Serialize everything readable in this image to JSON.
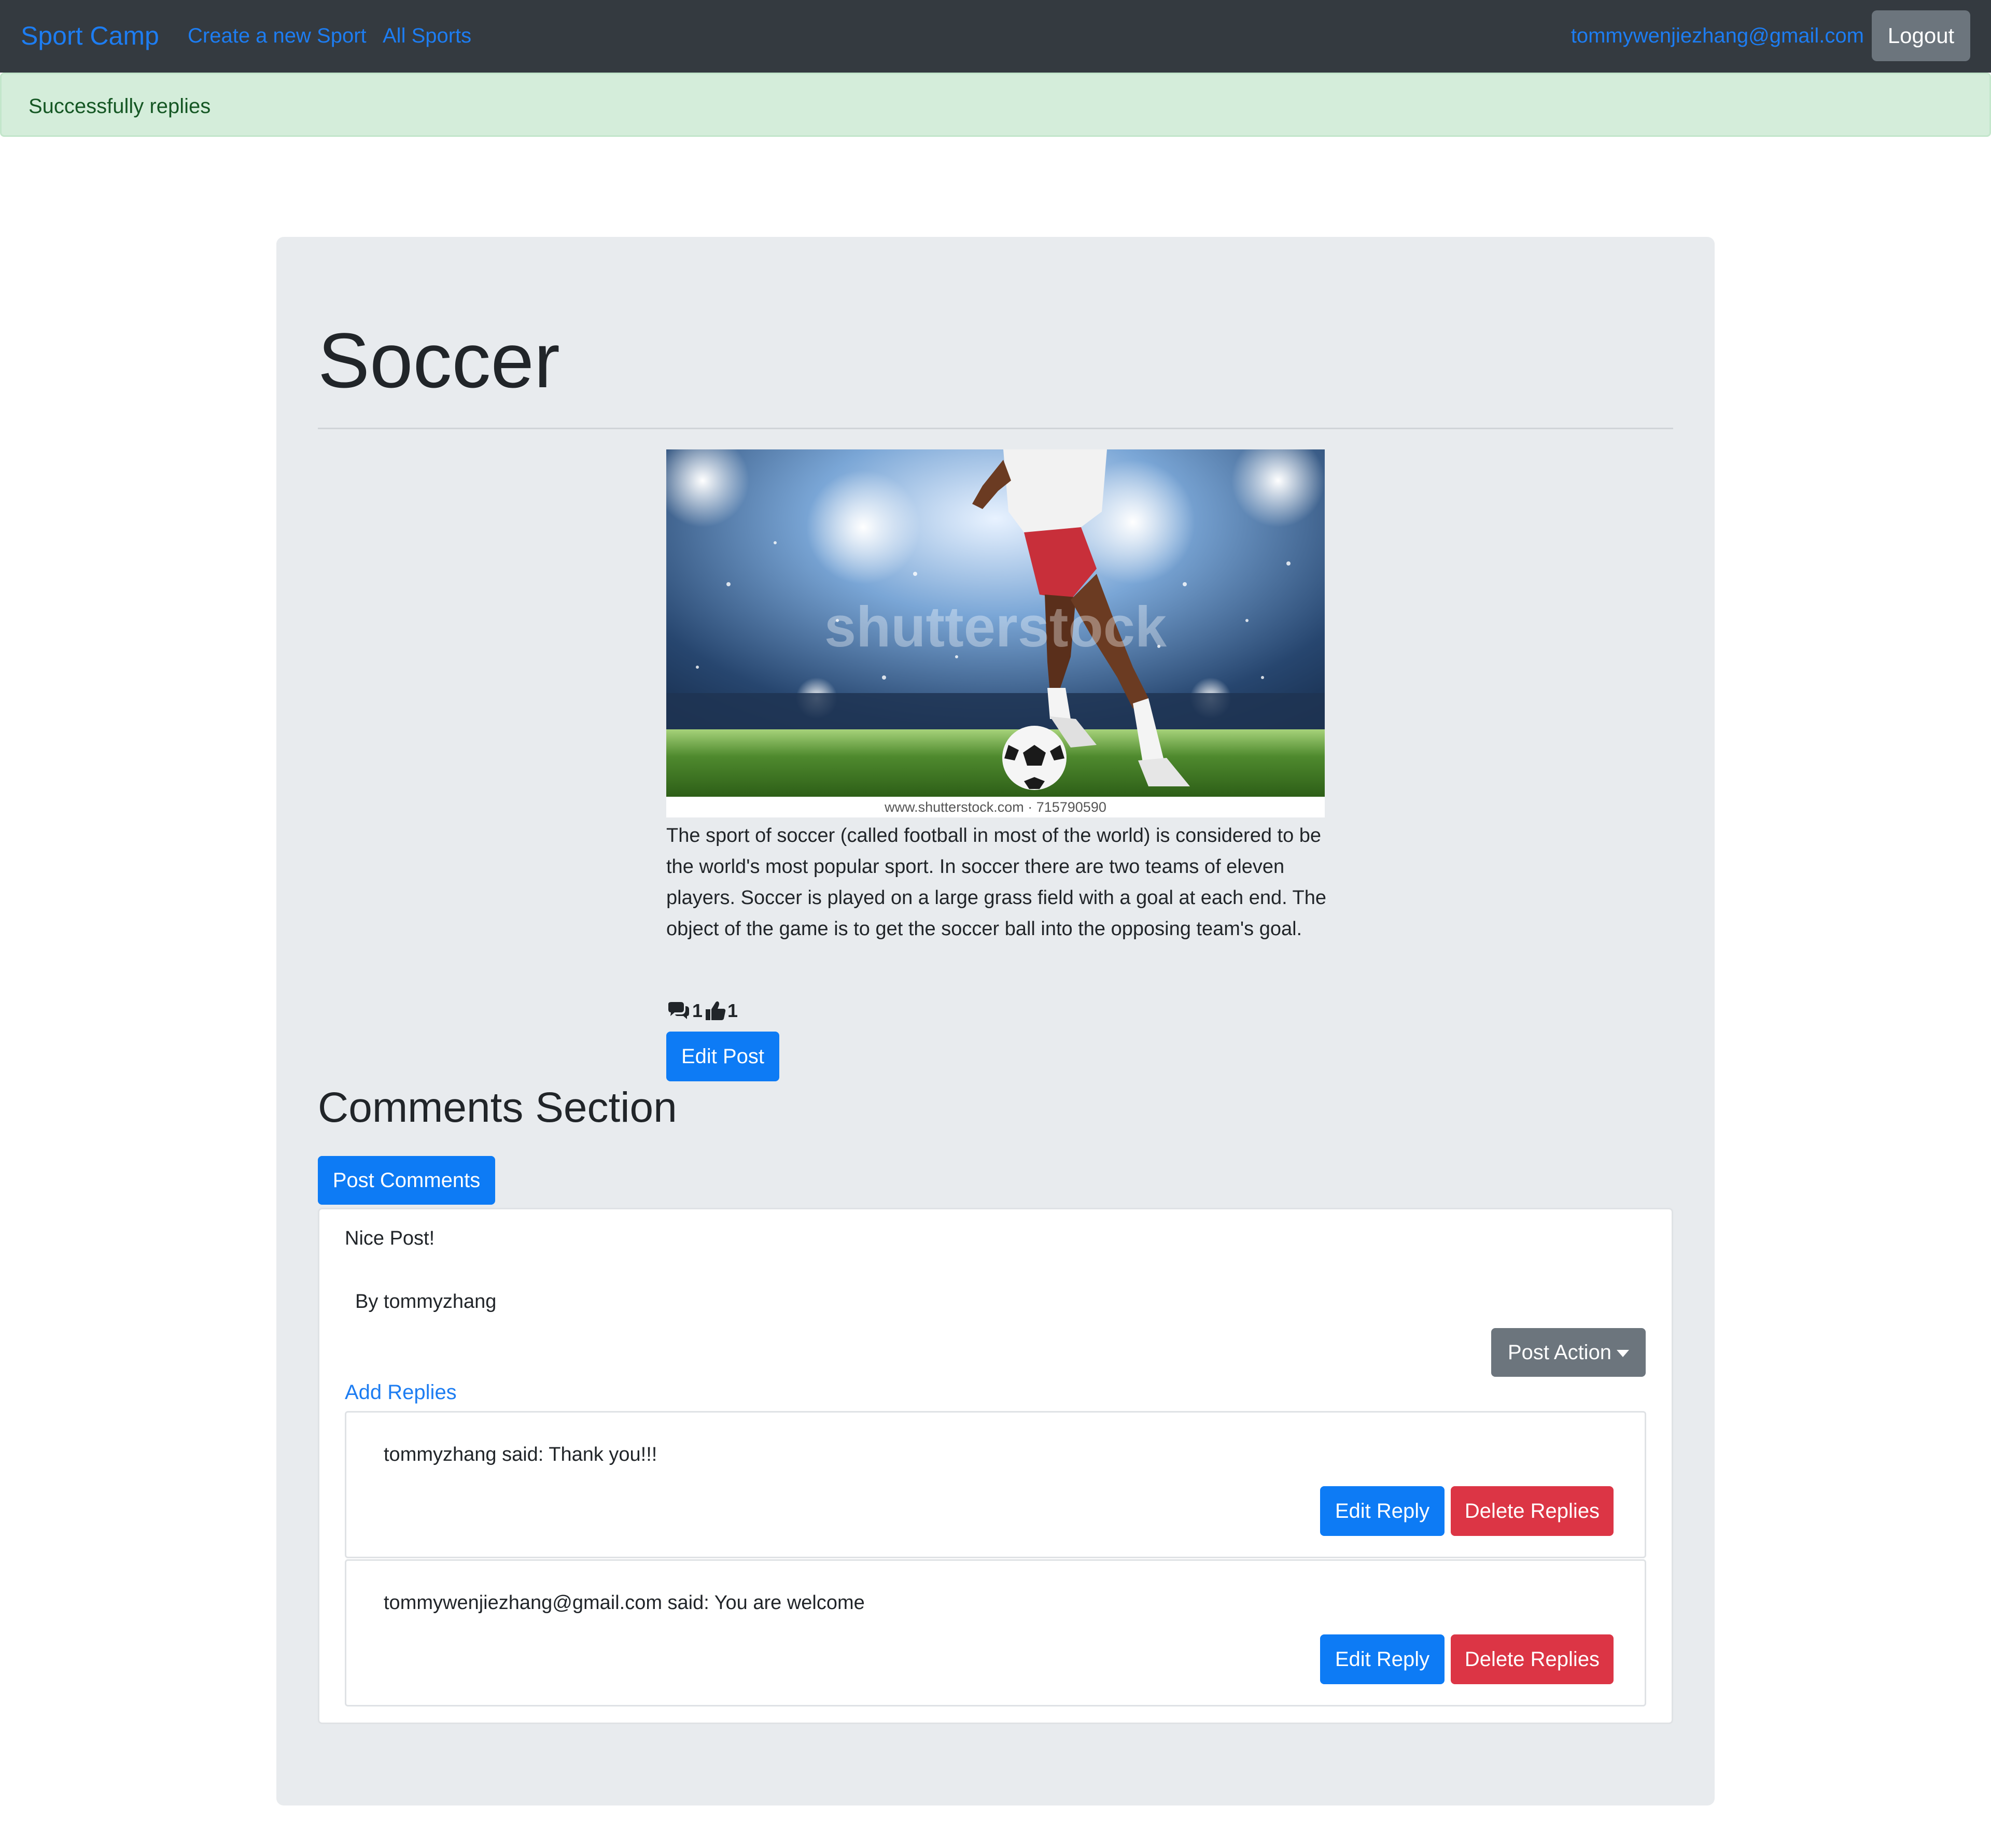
{
  "navbar": {
    "brand": "Sport Camp",
    "create_link": "Create a new Sport",
    "all_link": "All Sports",
    "user_email": "tommywenjiezhang@gmail.com",
    "logout_label": "Logout"
  },
  "alert": {
    "message": "Successfully replies"
  },
  "post": {
    "title": "Soccer",
    "image_caption": "www.shutterstock.com · 715790590",
    "image_watermark": "shutterstock",
    "description": "The sport of soccer (called football in most of the world) is considered to be the world's most popular sport. In soccer there are two teams of eleven players. Soccer is played on a large grass field with a goal at each end. The object of the game is to get the soccer ball into the opposing team's goal.",
    "comment_count": "1",
    "like_count": "1",
    "edit_label": "Edit Post"
  },
  "comments": {
    "heading": "Comments Section",
    "post_button": "Post Comments",
    "items": [
      {
        "text": "Nice Post!",
        "author": "By tommyzhang",
        "action_label": "Post Action",
        "add_replies_label": "Add Replies",
        "replies": [
          {
            "text": "tommyzhang said: Thank you!!!",
            "edit_label": "Edit Reply",
            "delete_label": "Delete Replies"
          },
          {
            "text": "tommywenjiezhang@gmail.com said: You are welcome",
            "edit_label": "Edit Reply",
            "delete_label": "Delete Replies"
          }
        ]
      }
    ]
  },
  "colors": {
    "navbar_bg": "#343a40",
    "link": "#1d7df2",
    "primary": "#0d7bf5",
    "danger": "#dc3545",
    "secondary": "#6c757d",
    "alert_bg": "#d4edda",
    "jumbotron_bg": "#e8ebee"
  },
  "icons": {
    "comments": "comments-icon",
    "like": "thumbs-up-icon",
    "caret": "caret-down-icon"
  }
}
